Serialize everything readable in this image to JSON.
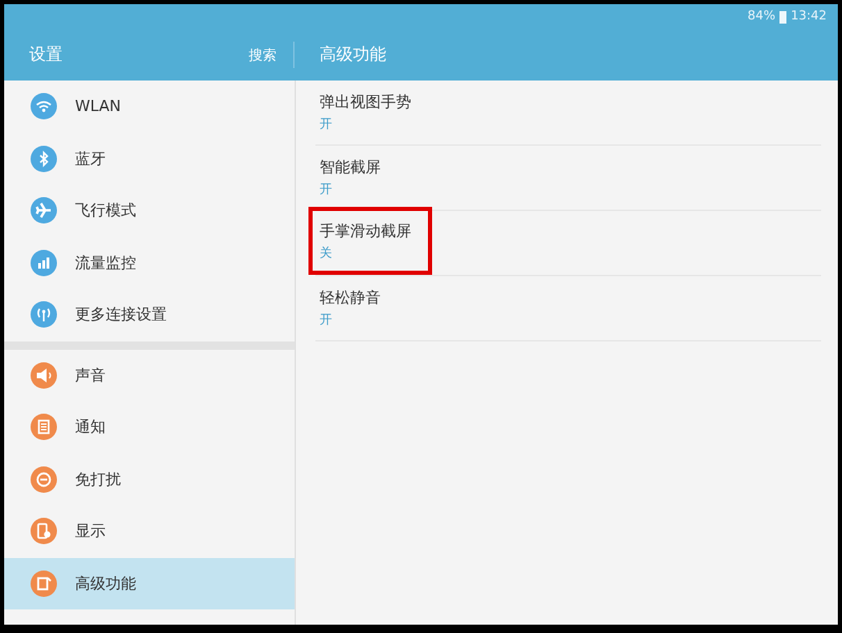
{
  "status_bar": {
    "battery": "84%",
    "time": "13:42"
  },
  "header": {
    "title": "设置",
    "search": "搜索",
    "page_title": "高级功能"
  },
  "sidebar": {
    "groups": [
      {
        "items": [
          {
            "label": "WLAN",
            "kind": "wifi",
            "color": "#4ea9e0",
            "selected": false
          },
          {
            "label": "蓝牙",
            "kind": "bluetooth",
            "color": "#4ea9e0",
            "selected": false
          },
          {
            "label": "飞行模式",
            "kind": "plane",
            "color": "#4ea9e0",
            "selected": false
          },
          {
            "label": "流量监控",
            "kind": "bars",
            "color": "#4ea9e0",
            "selected": false
          },
          {
            "label": "更多连接设置",
            "kind": "antenna",
            "color": "#4ea9e0",
            "selected": false
          }
        ]
      },
      {
        "items": [
          {
            "label": "声音",
            "kind": "speaker",
            "color": "#f08a4b",
            "selected": false
          },
          {
            "label": "通知",
            "kind": "note",
            "color": "#f08a4b",
            "selected": false
          },
          {
            "label": "免打扰",
            "kind": "minus",
            "color": "#f08a4b",
            "selected": false
          },
          {
            "label": "显示",
            "kind": "phone",
            "color": "#f08a4b",
            "selected": false
          },
          {
            "label": "高级功能",
            "kind": "cup",
            "color": "#f08a4b",
            "selected": true
          }
        ]
      }
    ]
  },
  "settings": [
    {
      "title": "弹出视图手势",
      "value": "开",
      "highlighted": false
    },
    {
      "title": "智能截屏",
      "value": "开",
      "highlighted": false
    },
    {
      "title": "手掌滑动截屏",
      "value": "关",
      "highlighted": true
    },
    {
      "title": "轻松静音",
      "value": "开",
      "highlighted": false
    }
  ]
}
